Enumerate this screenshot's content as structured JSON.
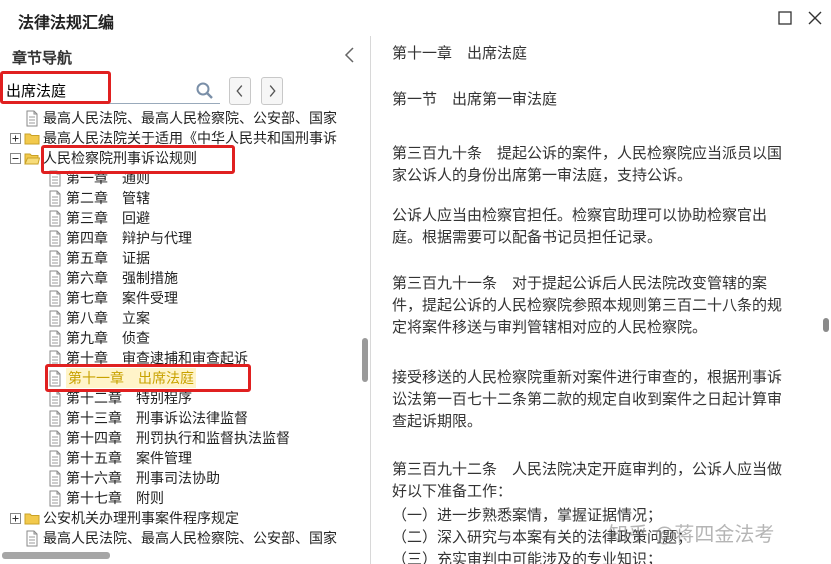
{
  "window": {
    "title": "法律法规汇编",
    "maximize_icon": "maximize-icon",
    "close_icon": "close-icon"
  },
  "sidebar": {
    "title": "章节导航",
    "collapse_icon": "chevron-left-icon",
    "search": {
      "value": "出席法庭",
      "placeholder": ""
    },
    "tree": [
      {
        "label": "最高人民法院、最高人民检察院、公安部、国家",
        "level": 1,
        "icon": "document-icon",
        "expander": "none"
      },
      {
        "label": "最高人民法院关于适用《中华人民共和国刑事诉",
        "level": 1,
        "icon": "folder-icon",
        "expander": "plus"
      },
      {
        "label": "人民检察院刑事诉讼规则",
        "level": 1,
        "icon": "folder-open-icon",
        "expander": "minus"
      },
      {
        "label": "第一章　通则",
        "level": 2,
        "icon": "document-icon",
        "expander": "none"
      },
      {
        "label": "第二章　管辖",
        "level": 2,
        "icon": "document-icon",
        "expander": "none"
      },
      {
        "label": "第三章　回避",
        "level": 2,
        "icon": "document-icon",
        "expander": "none"
      },
      {
        "label": "第四章　辩护与代理",
        "level": 2,
        "icon": "document-icon",
        "expander": "none"
      },
      {
        "label": "第五章　证据",
        "level": 2,
        "icon": "document-icon",
        "expander": "none"
      },
      {
        "label": "第六章　强制措施",
        "level": 2,
        "icon": "document-icon",
        "expander": "none"
      },
      {
        "label": "第七章　案件受理",
        "level": 2,
        "icon": "document-icon",
        "expander": "none"
      },
      {
        "label": "第八章　立案",
        "level": 2,
        "icon": "document-icon",
        "expander": "none"
      },
      {
        "label": "第九章　侦查",
        "level": 2,
        "icon": "document-icon",
        "expander": "none"
      },
      {
        "label": "第十章　审查逮捕和审查起诉",
        "level": 2,
        "icon": "document-icon",
        "expander": "none"
      },
      {
        "label": "第十一章　出席法庭",
        "level": 2,
        "icon": "document-icon",
        "expander": "none",
        "selected": true
      },
      {
        "label": "第十二章　特别程序",
        "level": 2,
        "icon": "document-icon",
        "expander": "none"
      },
      {
        "label": "第十三章　刑事诉讼法律监督",
        "level": 2,
        "icon": "document-icon",
        "expander": "none"
      },
      {
        "label": "第十四章　刑罚执行和监督执法监督",
        "level": 2,
        "icon": "document-icon",
        "expander": "none"
      },
      {
        "label": "第十五章　案件管理",
        "level": 2,
        "icon": "document-icon",
        "expander": "none"
      },
      {
        "label": "第十六章　刑事司法协助",
        "level": 2,
        "icon": "document-icon",
        "expander": "none"
      },
      {
        "label": "第十七章　附则",
        "level": 2,
        "icon": "document-icon",
        "expander": "none"
      },
      {
        "label": "公安机关办理刑事案件程序规定",
        "level": 1,
        "icon": "folder-icon",
        "expander": "plus"
      },
      {
        "label": "最高人民法院、最高人民检察院、公安部、国家",
        "level": 1,
        "icon": "document-icon",
        "expander": "none"
      }
    ]
  },
  "content": {
    "paragraphs": [
      "第十一章　出席法庭",
      "第一节　出席第一审法庭",
      "第三百九十条　提起公诉的案件，人民检察院应当派员以国家公诉人的身份出席第一审法庭，支持公诉。",
      "公诉人应当由检察官担任。检察官助理可以协助检察官出庭。根据需要可以配备书记员担任记录。",
      "第三百九十一条　对于提起公诉后人民法院改变管辖的案件，提起公诉的人民检察院参照本规则第三百二十八条的规定将案件移送与审判管辖相对应的人民检察院。",
      "接受移送的人民检察院重新对案件进行审查的，根据刑事诉讼法第一百七十二条第二款的规定自收到案件之日起计算审查起诉期限。",
      "第三百九十二条　人民法院决定开庭审判的，公诉人应当做好以下准备工作：",
      "（一）进一步熟悉案情，掌握证据情况；",
      "（二）深入研究与本案有关的法律政策问题；",
      "（三）充实审判中可能涉及的专业知识；"
    ]
  },
  "watermark": "知乎 @蒋四金法考",
  "colors": {
    "highlight_box": "#e02020",
    "selected_text": "#c8a200",
    "folder": "#f2c94c"
  }
}
